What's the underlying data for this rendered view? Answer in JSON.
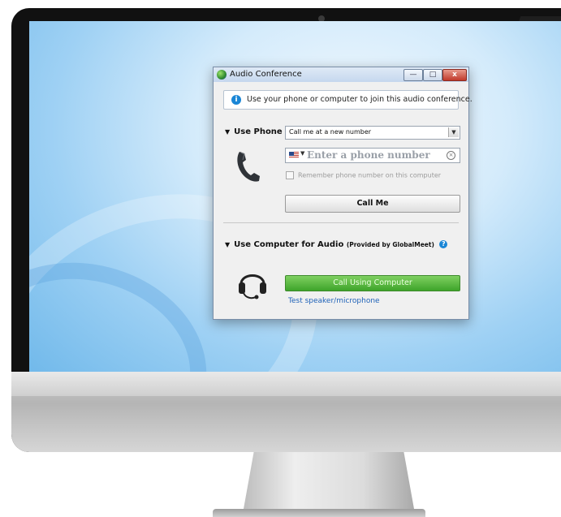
{
  "window": {
    "title": "Audio Conference",
    "controls": {
      "minimize": "—",
      "maximize": "□",
      "close": "x"
    }
  },
  "info_banner": {
    "icon": "info-icon",
    "text": "Use your phone or computer to join this audio conference."
  },
  "use_phone": {
    "heading": "Use Phone",
    "mode_select": {
      "selected": "Call me at a new number"
    },
    "phone_input": {
      "placeholder": "Enter a phone number",
      "country_flag": "us-flag-icon"
    },
    "remember_label": "Remember phone number on this computer",
    "remember_checked": false,
    "call_me_label": "Call Me"
  },
  "use_computer": {
    "heading": "Use Computer for Audio",
    "provider": "(Provided by GlobalMeet)",
    "call_button_label": "Call Using Computer",
    "test_link": "Test speaker/microphone"
  },
  "colors": {
    "accent_blue": "#1a86d6",
    "call_green": "#3ea42a",
    "link_blue": "#1f62b8"
  }
}
